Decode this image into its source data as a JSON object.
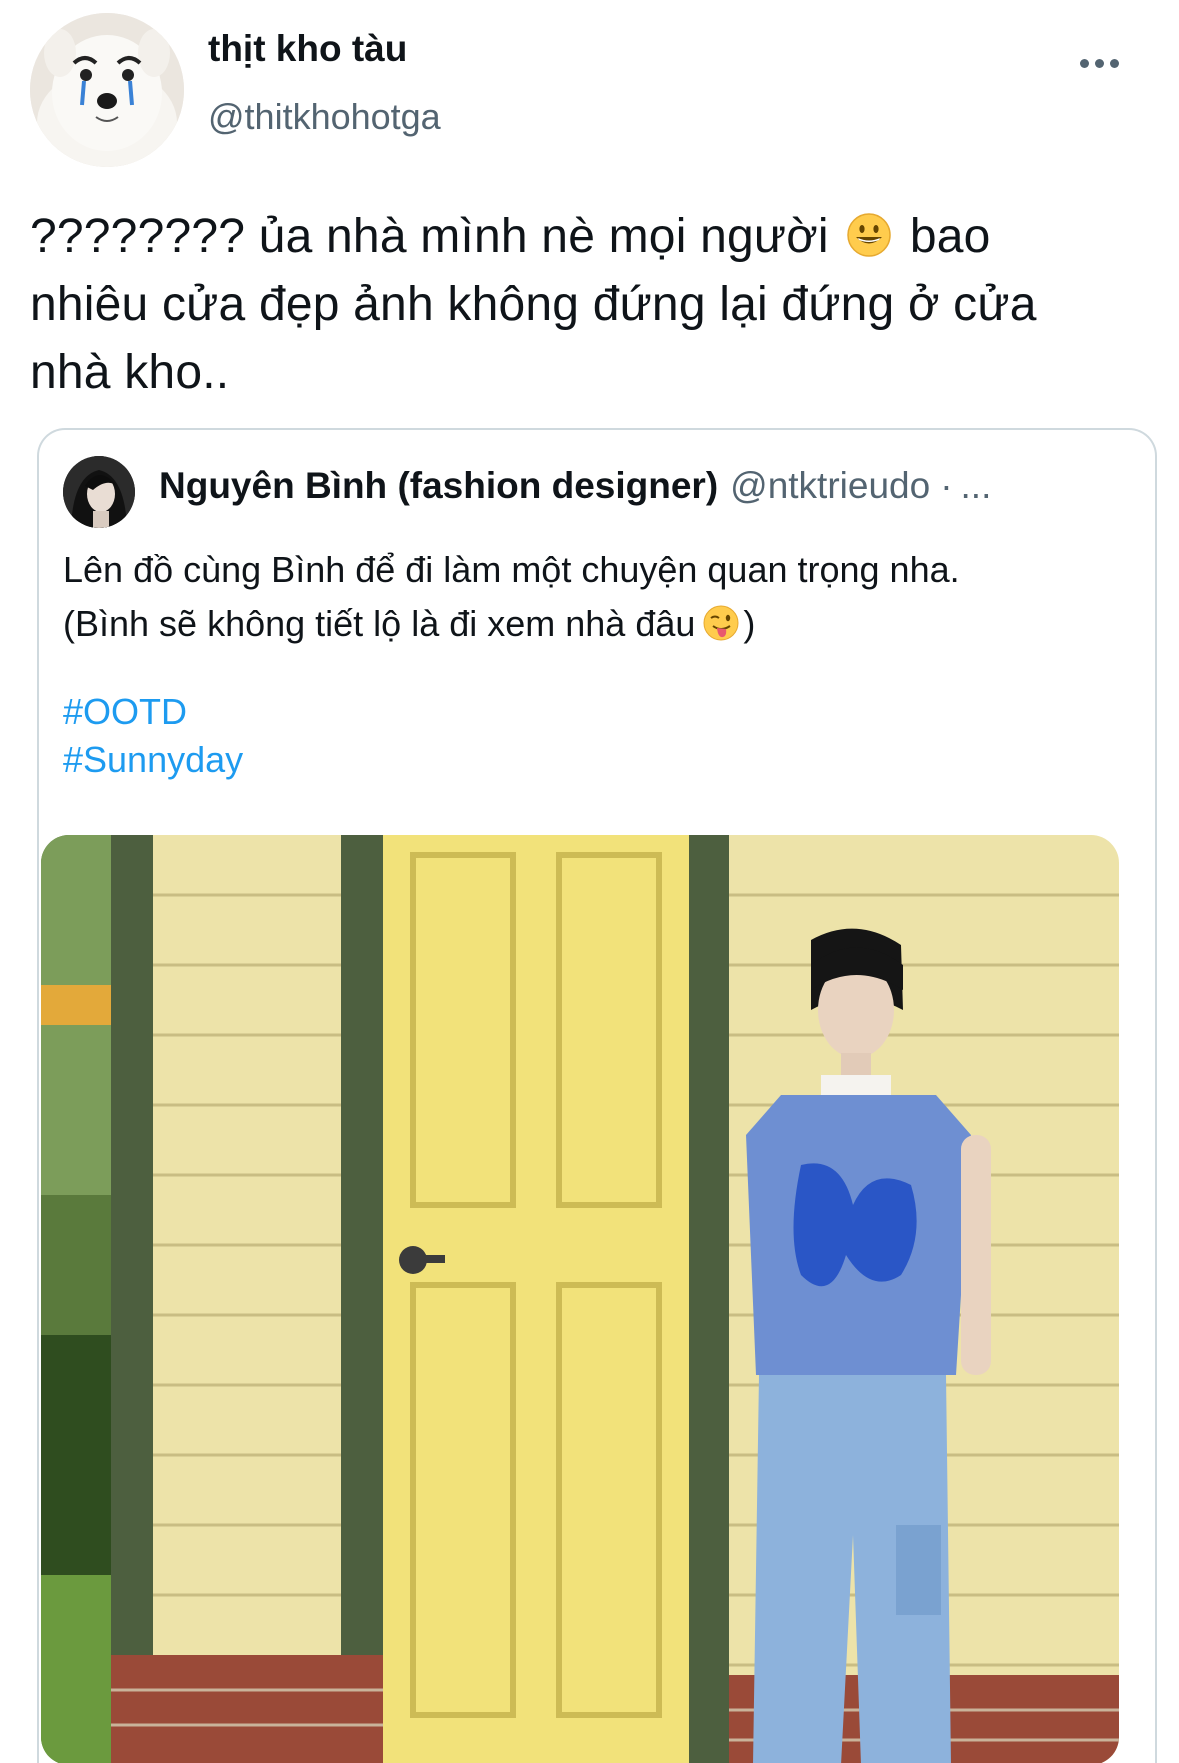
{
  "tweet": {
    "display_name": "thịt kho tàu",
    "handle": "@thitkhohotga",
    "avatar_icon": "samoyed-dog-avatar",
    "text_lines": [
      "???????? ủa nhà mình nè mọi người",
      "bao",
      "nhiêu cửa đẹp ảnh không đứng lại đứng ở cửa",
      "nhà kho.."
    ],
    "emoji": "grinning-face"
  },
  "quoted_tweet": {
    "display_name": "Nguyên Bình (fashion designer)",
    "handle": "@ntktrieudo",
    "separator": "·",
    "more": "...",
    "text_lines": [
      "Lên đồ cùng Bình để đi làm một chuyện quan trọng nha.",
      "(Bình sẽ không tiết lộ là đi xem nhà đâu",
      ")"
    ],
    "emoji": "winking-face-with-tongue",
    "hashtags": [
      "#OOTD",
      "#Sunnyday"
    ],
    "photo": "person-in-blue-knit-vest-leaning-against-yellow-wooden-wall-next-to-yellow-door"
  },
  "colors": {
    "text": "#0f1419",
    "secondary": "#536471",
    "link": "#1d9bf0",
    "border": "#cfd9de"
  }
}
